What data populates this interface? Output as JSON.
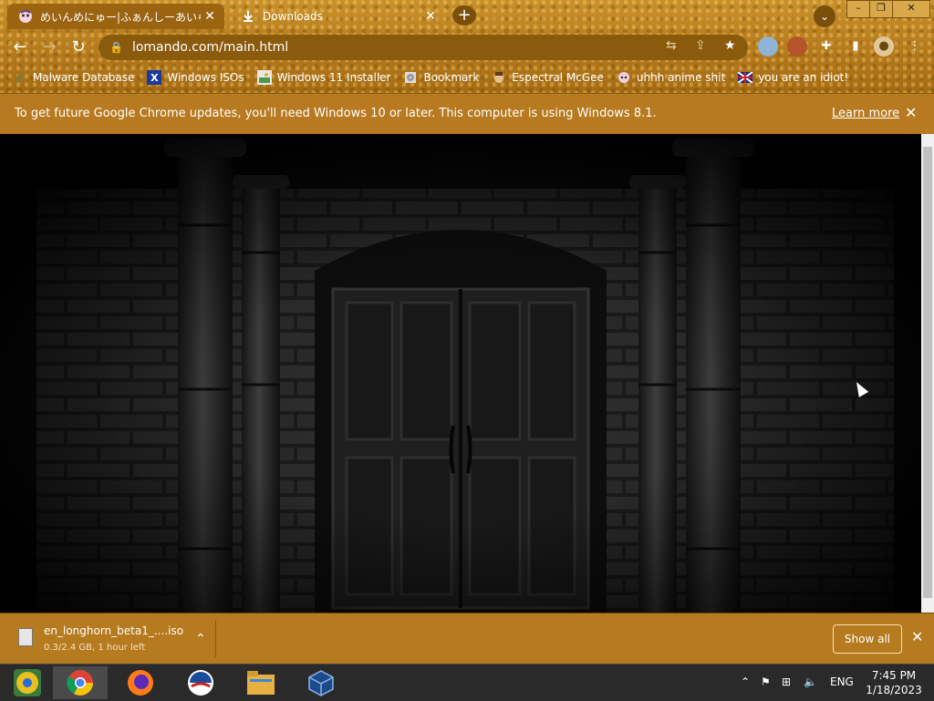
{
  "tabs": [
    {
      "title": "めいんめにゅー|ふぁんしーあいらんど",
      "active": true
    },
    {
      "title": "Downloads",
      "active": false
    }
  ],
  "new_tab_label": "+",
  "toolbar": {
    "url": "lomando.com/main.html"
  },
  "bookmarks": [
    {
      "label": "Malware Database",
      "icon": "leaf-icon"
    },
    {
      "label": "Windows ISOs",
      "icon": "x-icon"
    },
    {
      "label": "Windows 11 Installer",
      "icon": "image-icon"
    },
    {
      "label": "Bookmark",
      "icon": "cd-icon"
    },
    {
      "label": "Espectral McGee",
      "icon": "face-icon"
    },
    {
      "label": "uhhh anime shit",
      "icon": "anime-icon"
    },
    {
      "label": "you are an idiot!",
      "icon": "flag-icon"
    }
  ],
  "infobar": {
    "message": "To get future Google Chrome updates, you'll need Windows 10 or later. This computer is using Windows 8.1.",
    "learn_more": "Learn more"
  },
  "download": {
    "filename": "en_longhorn_beta1_....iso",
    "status": "0.3/2.4 GB, 1 hour left",
    "show_all": "Show all"
  },
  "taskbar": {
    "apps": [
      "chrome-beta-icon",
      "chrome-icon",
      "firefox-icon",
      "obama-logo-icon",
      "file-explorer-icon",
      "virtualbox-icon"
    ],
    "language": "ENG",
    "time": "7:45 PM",
    "date": "1/18/2023"
  }
}
